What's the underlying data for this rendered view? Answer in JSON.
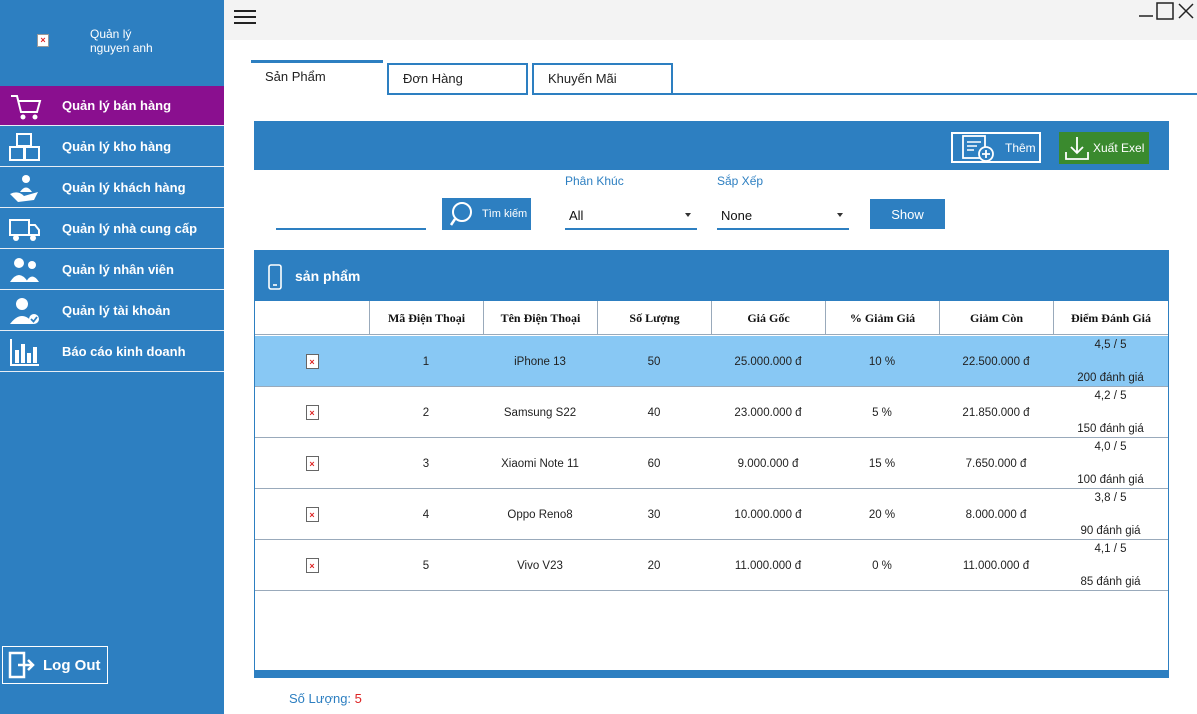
{
  "user": {
    "name": "Quản lý\nnguyen anh"
  },
  "sidebar": {
    "items": [
      {
        "label": "Quản lý bán hàng",
        "icon": "cart-icon",
        "active": true
      },
      {
        "label": "Quản lý kho hàng",
        "icon": "boxes-icon",
        "active": false
      },
      {
        "label": "Quản lý khách hàng",
        "icon": "customer-care-icon",
        "active": false
      },
      {
        "label": "Quản lý nhà cung cấp",
        "icon": "truck-icon",
        "active": false
      },
      {
        "label": "Quản lý nhân viên",
        "icon": "staff-icon",
        "active": false
      },
      {
        "label": "Quản lý tài khoản",
        "icon": "user-check-icon",
        "active": false
      },
      {
        "label": "Báo cáo kinh doanh",
        "icon": "bar-chart-icon",
        "active": false
      }
    ],
    "logout_label": "Log Out"
  },
  "tabs": [
    {
      "label": "Sản Phẩm",
      "active": true
    },
    {
      "label": "Đơn Hàng",
      "active": false
    },
    {
      "label": "Khuyến Mãi",
      "active": false
    }
  ],
  "toolbar": {
    "add_label": "Thêm",
    "export_label": "Xuất Exel"
  },
  "filters": {
    "search_value": "",
    "search_button": "Tìm kiếm",
    "segment_label": "Phân Khúc",
    "segment_value": "All",
    "sort_label": "Sắp Xếp",
    "sort_value": "None",
    "show_button": "Show"
  },
  "grid": {
    "title": "sản phẩm",
    "columns": [
      "",
      "Mã Điện Thoại",
      "Tên Điện Thoại",
      "Số Lượng",
      "Giá Gốc",
      "% Giảm Giá",
      "Giảm Còn",
      "Điểm Đánh Giá"
    ],
    "rows": [
      {
        "id": "1",
        "name": "iPhone 13",
        "qty": "50",
        "price": "25.000.000 đ",
        "discount": "10 %",
        "final": "22.500.000 đ",
        "rating": "4,5 / 5",
        "reviews": "200 đánh giá"
      },
      {
        "id": "2",
        "name": "Samsung S22",
        "qty": "40",
        "price": "23.000.000 đ",
        "discount": "5 %",
        "final": "21.850.000 đ",
        "rating": "4,2 / 5",
        "reviews": "150 đánh giá"
      },
      {
        "id": "3",
        "name": "Xiaomi Note 11",
        "qty": "60",
        "price": "9.000.000 đ",
        "discount": "15 %",
        "final": "7.650.000 đ",
        "rating": "4,0 / 5",
        "reviews": "100 đánh giá"
      },
      {
        "id": "4",
        "name": "Oppo Reno8",
        "qty": "30",
        "price": "10.000.000 đ",
        "discount": "20 %",
        "final": "8.000.000 đ",
        "rating": "3,8 / 5",
        "reviews": "90 đánh giá"
      },
      {
        "id": "5",
        "name": "Vivo V23",
        "qty": "20",
        "price": "11.000.000 đ",
        "discount": "0 %",
        "final": "11.000.000 đ",
        "rating": "4,1 / 5",
        "reviews": "85 đánh giá"
      }
    ]
  },
  "footer": {
    "count_label": "Số Lượng:",
    "count_value": "5"
  },
  "colors": {
    "primary": "#2d7fc1",
    "active_nav": "#8a0f8f",
    "selected_row": "#88c8f4",
    "excel": "#3a8a2e"
  }
}
